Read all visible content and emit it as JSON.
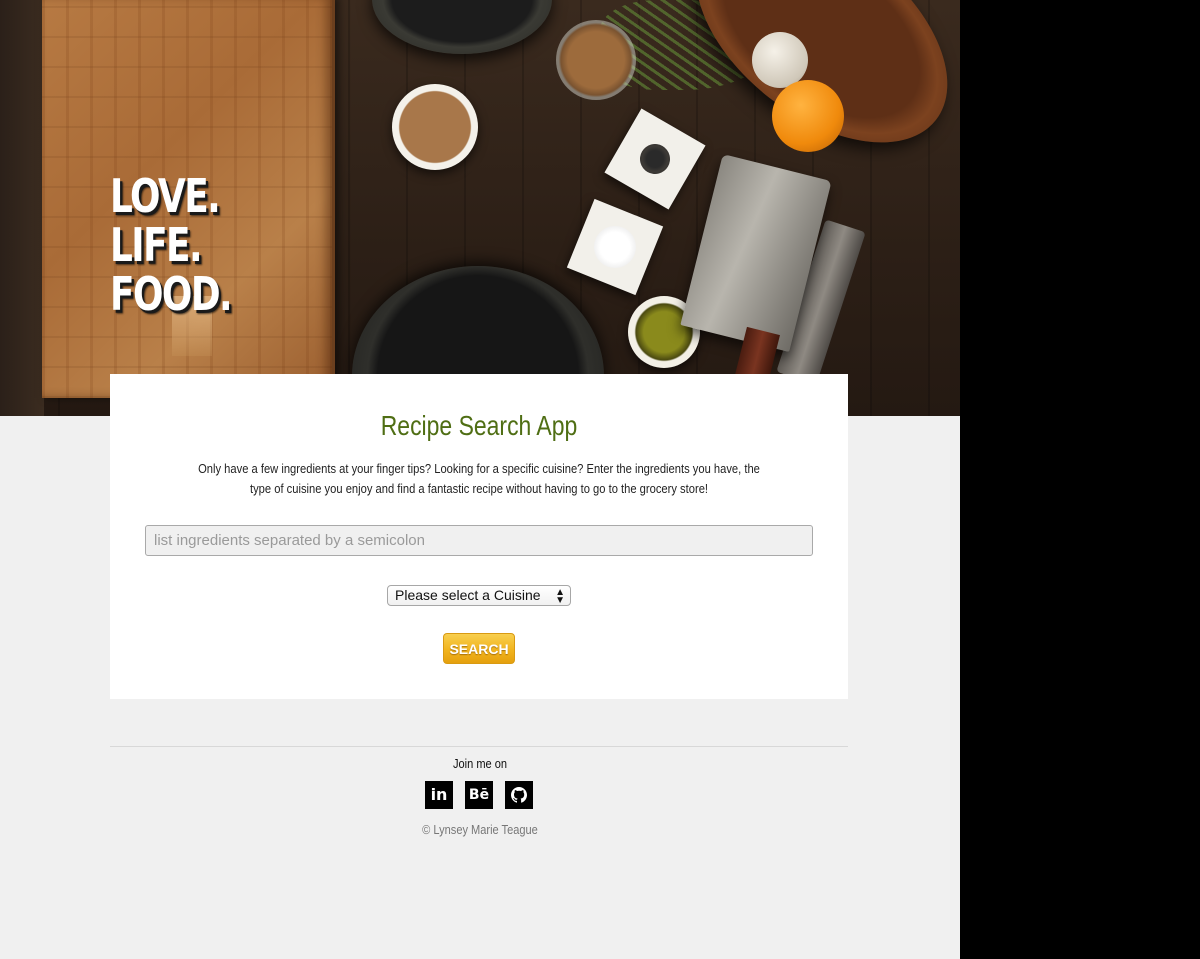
{
  "hero": {
    "tagline": [
      "LOVE.",
      "LIFE.",
      "FOOD."
    ]
  },
  "card": {
    "title": "Recipe Search App",
    "intro": "Only have a few ingredients at your finger tips? Looking for a specific cuisine? Enter the ingredients you have, the type of cuisine you enjoy and find a fantastic recipe without having to go to the grocery store!",
    "ingredients_placeholder": "list ingredients separated by a semicolon",
    "ingredients_value": "",
    "cuisine_selected": "Please select a Cuisine",
    "search_label": "SEARCH"
  },
  "footer": {
    "join_label": "Join me on",
    "social": [
      {
        "name": "linkedin-icon",
        "glyph": "in"
      },
      {
        "name": "behance-icon",
        "glyph": "Bē"
      },
      {
        "name": "github-icon",
        "glyph": "github"
      }
    ],
    "copyright": "© Lynsey Marie Teague"
  },
  "colors": {
    "title_green": "#4f6e14",
    "button_gold": "#f1b41e",
    "page_bg": "#f0f0f0"
  }
}
